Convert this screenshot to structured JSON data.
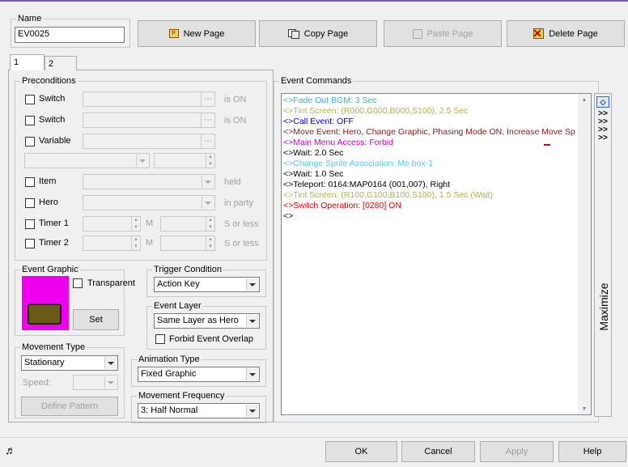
{
  "name": {
    "label": "Name",
    "value": "EV0025"
  },
  "toolbar": {
    "new_page": "New Page",
    "copy_page": "Copy Page",
    "paste_page": "Paste Page",
    "delete_page": "Delete Page"
  },
  "tabs": [
    "1",
    "2"
  ],
  "preconditions": {
    "title": "Preconditions",
    "switch1": "Switch",
    "switch2": "Switch",
    "variable": "Variable",
    "is_on": "is ON",
    "item": "Item",
    "held": "held",
    "hero": "Hero",
    "in_party": "in party",
    "timer1": "Timer 1",
    "timer2": "Timer 2",
    "m": "M",
    "s_or_less": "S or less"
  },
  "event_graphic": {
    "title": "Event Graphic",
    "transparent": "Transparent",
    "set": "Set",
    "sprite_color": "#ee00ee"
  },
  "trigger": {
    "title": "Trigger Condition",
    "value": "Action Key"
  },
  "event_layer": {
    "title": "Event Layer",
    "value": "Same Layer as Hero",
    "forbid": "Forbid Event Overlap"
  },
  "movement_type": {
    "title": "Movement Type",
    "value": "Stationary",
    "speed": "Speed:",
    "define": "Define Pattern"
  },
  "animation_type": {
    "title": "Animation Type",
    "value": "Fixed Graphic"
  },
  "movement_freq": {
    "title": "Movement Frequency",
    "value": "3: Half Normal"
  },
  "event_commands": {
    "title": "Event Commands",
    "lines": [
      {
        "text": "<>Fade Out BGM: 3 Sec",
        "color": "#3cb0c8"
      },
      {
        "text": "<>Tint Screen: (R000,G000,B000,S100), 2.5 Sec",
        "color": "#b4b43c"
      },
      {
        "text": "<>Call Event: OFF",
        "color": "#0000d8"
      },
      {
        "text": "<>Move Event: Hero, Change Graphic, Phasing Mode ON, Increase Move Sp",
        "color": "#8b1a1a"
      },
      {
        "text": "<>Main Menu Access: Forbid",
        "color": "#d000d0"
      },
      {
        "text": "<>Wait: 2.0 Sec",
        "color": "#000000"
      },
      {
        "text": "<>Change Sprite Association: Me box-1",
        "color": "#5ac8dc"
      },
      {
        "text": "<>Wait: 1.0 Sec",
        "color": "#000000"
      },
      {
        "text": "<>Teleport: 0164:MAP0164 (001,007), Right",
        "color": "#000000"
      },
      {
        "text": "<>Tint Screen: (R100,G100,B100,S100), 1.5 Sec (Wait)",
        "color": "#b4b43c"
      },
      {
        "text": "<>Switch Operation: [0280] ON",
        "color": "#e00000"
      },
      {
        "text": "<>",
        "color": "#000000"
      }
    ]
  },
  "maximize": {
    "chevrons": ">>>>>>>>",
    "label": "Maximize"
  },
  "footer": {
    "ok": "OK",
    "cancel": "Cancel",
    "apply": "Apply",
    "help": "Help"
  }
}
